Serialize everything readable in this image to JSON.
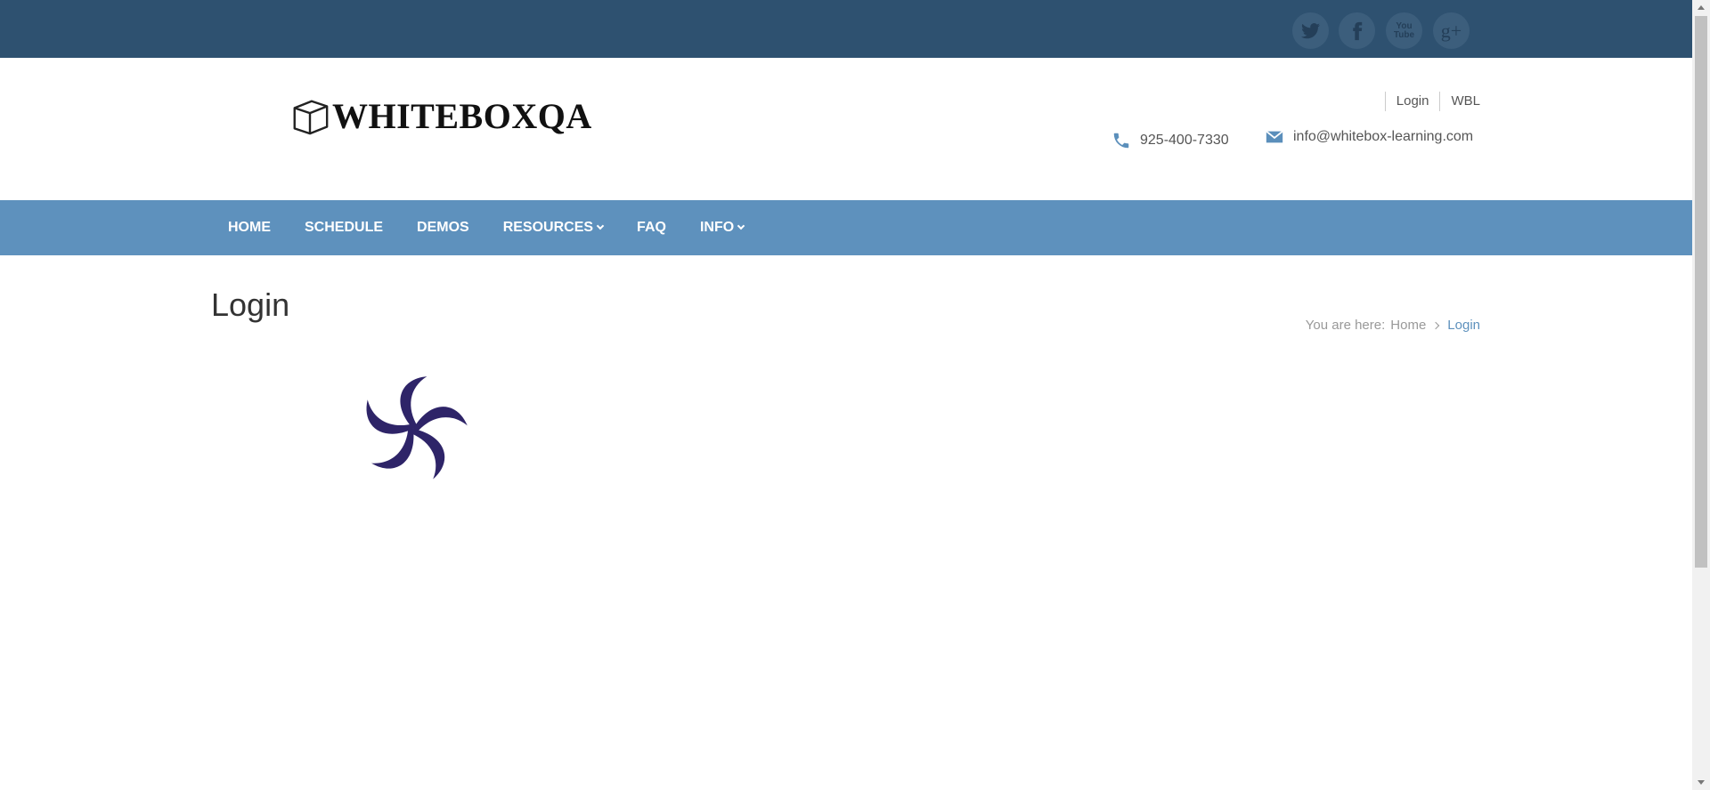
{
  "social": {
    "icons": [
      "twitter-icon",
      "facebook-icon",
      "youtube-icon",
      "google-plus-icon"
    ],
    "youtube_label": "You Tube",
    "googleplus_label": "g+"
  },
  "header": {
    "logo_text": "WHITEBOXQA",
    "top_links": [
      "Login",
      "WBL"
    ],
    "phone": "925-400-7330",
    "email": "info@whitebox-learning.com"
  },
  "nav": {
    "items": [
      "HOME",
      "SCHEDULE",
      "DEMOS",
      "RESOURCES",
      "FAQ",
      "INFO"
    ]
  },
  "page": {
    "title": "Login",
    "breadcrumb_prefix": "You are here:",
    "breadcrumb_home": "Home",
    "breadcrumb_current": "Login"
  },
  "colors": {
    "topbar": "#2e5170",
    "nav": "#5e91bd",
    "accent": "#5e91bd",
    "spinner": "#2e2468"
  }
}
